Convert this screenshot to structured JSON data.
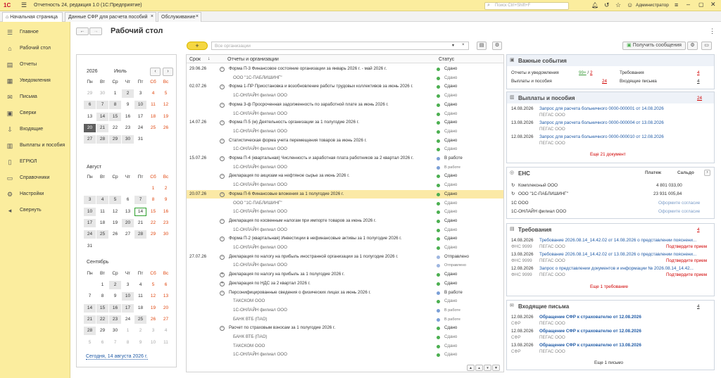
{
  "window": {
    "title": "Отчетность 24, редакция 1.0 (1С:Предприятие)",
    "search_placeholder": "Поиск Ctrl+Shift+F",
    "user": "Администратор"
  },
  "tabs": [
    {
      "label": "Начальная страница"
    },
    {
      "label": "Данные СФР для расчета пособий"
    },
    {
      "label": "Обслуживание"
    }
  ],
  "page_title": "Рабочий стол",
  "nav": [
    "Главное",
    "Рабочий стол",
    "Отчеты",
    "Уведомления",
    "Письма",
    "Сверки",
    "Входящие",
    "Выплаты и пособия",
    "ЕГРЮЛ",
    "Справочники",
    "Настройки",
    "Свернуть"
  ],
  "org_placeholder": "Все организации",
  "get_messages": "Получить сообщения",
  "calendar": {
    "year": "2026",
    "month1": "Июль",
    "month2": "Август",
    "month3": "Сентябрь",
    "weekdays": [
      "Пн",
      "Вт",
      "Ср",
      "Чт",
      "Пт",
      "Сб",
      "Вс"
    ],
    "today_link": "Сегодня, 14 августа 2026 г."
  },
  "list": {
    "headers": {
      "date": "Срок",
      "reports": "Отчеты и организации",
      "status": "Статус"
    },
    "rows": [
      {
        "d": "29.06.26",
        "t": "Форма П-3 Финансовое состояние организации за январь 2026 г. - май 2026 г.",
        "s": "Сдано",
        "lv": 0,
        "c": "#4caf50"
      },
      {
        "d": "",
        "t": "ООО \"1С-ПАБЛИШИНГ\"",
        "s": "Сдано",
        "lv": 1,
        "c": "#4caf50"
      },
      {
        "d": "02.07.26",
        "t": "Форма 1-ПР Приостановка и возобновление работы трудовых коллективов за июнь 2026 г.",
        "s": "Сдано",
        "lv": 0,
        "c": "#4caf50"
      },
      {
        "d": "",
        "t": "1С-ОНЛАЙН филиал ООО",
        "s": "Сдано",
        "lv": 1,
        "c": "#4caf50"
      },
      {
        "d": "",
        "t": "Форма 3-ф Просроченная задолженность по заработной плате за июнь 2026 г.",
        "s": "Сдано",
        "lv": 0,
        "c": "#4caf50"
      },
      {
        "d": "",
        "t": "1С-ОНЛАЙН филиал ООО",
        "s": "Сдано",
        "lv": 1,
        "c": "#4caf50"
      },
      {
        "d": "14.07.26",
        "t": "Форма П-5 (м) Деятельность организации за 1 полугодие 2026 г.",
        "s": "Сдано",
        "lv": 0,
        "c": "#4caf50"
      },
      {
        "d": "",
        "t": "1С-ОНЛАЙН филиал ООО",
        "s": "Сдано",
        "lv": 1,
        "c": "#4caf50"
      },
      {
        "d": "",
        "t": "Статистическая форма учета перемещения товаров за июнь 2026 г.",
        "s": "Сдано",
        "lv": 0,
        "c": "#4caf50"
      },
      {
        "d": "",
        "t": "1С-ОНЛАЙН филиал ООО",
        "s": "Сдано",
        "lv": 1,
        "c": "#4caf50"
      },
      {
        "d": "15.07.26",
        "t": "Форма П-4 (квартальная) Численность и заработная плата работников за 2 квартал 2026 г.",
        "s": "В работе",
        "lv": 0,
        "c": "#7b9fd6"
      },
      {
        "d": "",
        "t": "1С-ОНЛАЙН филиал ООО",
        "s": "В работе",
        "lv": 1,
        "c": "#7b9fd6"
      },
      {
        "d": "",
        "t": "Декларация по акцизам на нефтяное сырье за июнь 2026 г.",
        "s": "Сдано",
        "lv": 0,
        "c": "#4caf50"
      },
      {
        "d": "",
        "t": "1С-ОНЛАЙН филиал ООО",
        "s": "Сдано",
        "lv": 1,
        "c": "#4caf50"
      },
      {
        "d": "20.07.26",
        "t": "Форма П-6 Финансовые вложения за 1 полугодие 2026 г.",
        "s": "Сдано",
        "lv": 0,
        "c": "#4caf50",
        "hl": true
      },
      {
        "d": "",
        "t": "ООО \"1С-ПАБЛИШИНГ\"",
        "s": "Сдано",
        "lv": 1,
        "c": "#4caf50"
      },
      {
        "d": "",
        "t": "1С-ОНЛАЙН филиал ООО",
        "s": "Сдано",
        "lv": 1,
        "c": "#4caf50"
      },
      {
        "d": "",
        "t": "Декларация по косвенным налогам при импорте товаров за июнь 2026 г.",
        "s": "Сдано",
        "lv": 0,
        "c": "#4caf50"
      },
      {
        "d": "",
        "t": "1С-ОНЛАЙН филиал ООО",
        "s": "Сдано",
        "lv": 1,
        "c": "#4caf50"
      },
      {
        "d": "",
        "t": "Форма П-2 (квартальная) Инвестиции в нефинансовые активы за 1 полугодие 2026 г.",
        "s": "Сдано",
        "lv": 0,
        "c": "#4caf50"
      },
      {
        "d": "",
        "t": "1С-ОНЛАЙН филиал ООО",
        "s": "Сдано",
        "lv": 1,
        "c": "#4caf50"
      },
      {
        "d": "27.07.26",
        "t": "Декларация по налогу на прибыль иностранной организации за 1 полугодие 2026 г.",
        "s": "Отправлено",
        "lv": 0,
        "c": "#9eb6e0"
      },
      {
        "d": "",
        "t": "1С-ОНЛАЙН филиал ООО",
        "s": "Отправлено",
        "lv": 1,
        "c": "#9eb6e0"
      },
      {
        "d": "",
        "t": "Декларация по налогу на прибыль за 1 полугодие 2026 г.",
        "s": "Сдано",
        "lv": 0,
        "c": "#4caf50",
        "plus": true
      },
      {
        "d": "",
        "t": "Декларация по НДС за 2 квартал 2026 г.",
        "s": "Сдано",
        "lv": 0,
        "c": "#4caf50",
        "plus": true
      },
      {
        "d": "",
        "t": "Персонифицированные сведения о физических лицах за июнь 2026 г.",
        "s": "В работе",
        "lv": 0,
        "c": "#7b9fd6"
      },
      {
        "d": "",
        "t": "ТАКСКОМ ООО",
        "s": "Сдано",
        "lv": 1,
        "c": "#4caf50"
      },
      {
        "d": "",
        "t": "1С-ОНЛАЙН филиал ООО",
        "s": "В работе",
        "lv": 1,
        "c": "#7b9fd6"
      },
      {
        "d": "",
        "t": "БАНК ВТБ (ПАО)",
        "s": "В работе",
        "lv": 1,
        "c": "#7b9fd6"
      },
      {
        "d": "",
        "t": "Расчет по страховым взносам за 1 полугодие 2026 г.",
        "s": "Сдано",
        "lv": 0,
        "c": "#4caf50"
      },
      {
        "d": "",
        "t": "БАНК ВТБ (ПАО)",
        "s": "Сдано",
        "lv": 1,
        "c": "#4caf50"
      },
      {
        "d": "",
        "t": "ТАКСКОМ ООО",
        "s": "Сдано",
        "lv": 1,
        "c": "#4caf50"
      },
      {
        "d": "",
        "t": "1С-ОНЛАЙН филиал ООО",
        "s": "Сдано",
        "lv": 1,
        "c": "#4caf50"
      }
    ]
  },
  "important": {
    "title": "Важные события",
    "reports_label": "Отчеты и уведомления",
    "reports_val1": "99+",
    "reports_val2": "2",
    "payments_label": "Выплаты и пособия",
    "payments_val": "24",
    "req_label": "Требования",
    "req_val": "4",
    "incoming_label": "Входящие письма",
    "incoming_val": "4"
  },
  "payments": {
    "title": "Выплаты и пособия",
    "count": "24",
    "items": [
      {
        "date": "14.08.2026",
        "text": "Запрос для расчета больничного 0000-000001 от 14.08.2026",
        "sub": "ПЕГАС ООО"
      },
      {
        "date": "13.08.2026",
        "text": "Запрос для расчета больничного 0000-000004 от 13.08.2026",
        "sub": "ПЕГАС ООО"
      },
      {
        "date": "12.08.2026",
        "text": "Запрос для расчета больничного 0000-000010 от 12.08.2026",
        "sub": "ПЕГАС ООО"
      }
    ],
    "more": "Еще 21 документ"
  },
  "ens": {
    "title": "ЕНС",
    "col1": "Платеж",
    "col2": "Сальдо",
    "rows": [
      {
        "name": "Комплексный ООО",
        "val": "4 801 033,00"
      },
      {
        "name": "ООО \"1С-ПАБЛИШИНГ\"",
        "val": "23 931 005,84"
      },
      {
        "name": "1С ООО",
        "val": "Оформите согласие"
      },
      {
        "name": "1С-ОНЛАЙН филиал ООО",
        "val": "Оформите согласие"
      }
    ]
  },
  "requirements": {
    "title": "Требования",
    "count": "4",
    "items": [
      {
        "date": "14.08.2026",
        "code": "ФНС 9999",
        "text": "Требование 2026.08.14_14.42.02 от 14.08.2026 о представлении пояснени...",
        "sub": "ПЕГАС ООО",
        "action": "Подтвердите прием"
      },
      {
        "date": "13.08.2026",
        "code": "ФНС 9999",
        "text": "Требование 2026.08.14_14.42.02 от 13.08.2026 о представлении пояснени...",
        "sub": "ПЕГАС ООО",
        "action": "Подтвердите прием"
      },
      {
        "date": "12.08.2026",
        "code": "ФНС 9999",
        "text": "Запрос о представлении документов и информации № 2026.08.14_14.42...",
        "sub": "ПЕГАС ООО",
        "action": "Подтвердите прием"
      }
    ],
    "more": "Еще 1 требование"
  },
  "incoming": {
    "title": "Входящие письма",
    "count": "4",
    "items": [
      {
        "date": "12.08.2026",
        "code": "СФР",
        "text": "Обращение СФР к страхователю от 12.08.2026",
        "sub": "ПЕГАС ООО"
      },
      {
        "date": "12.08.2026",
        "code": "СФР",
        "text": "Обращение СФР к страхователю от 12.08.2026",
        "sub": "ПЕГАС ООО"
      },
      {
        "date": "13.08.2026",
        "code": "СФР",
        "text": "Обращение СФР к страхователю от 13.08.2026",
        "sub": "ПЕГАС ООО"
      }
    ],
    "more": "Еще 1 письмо"
  }
}
